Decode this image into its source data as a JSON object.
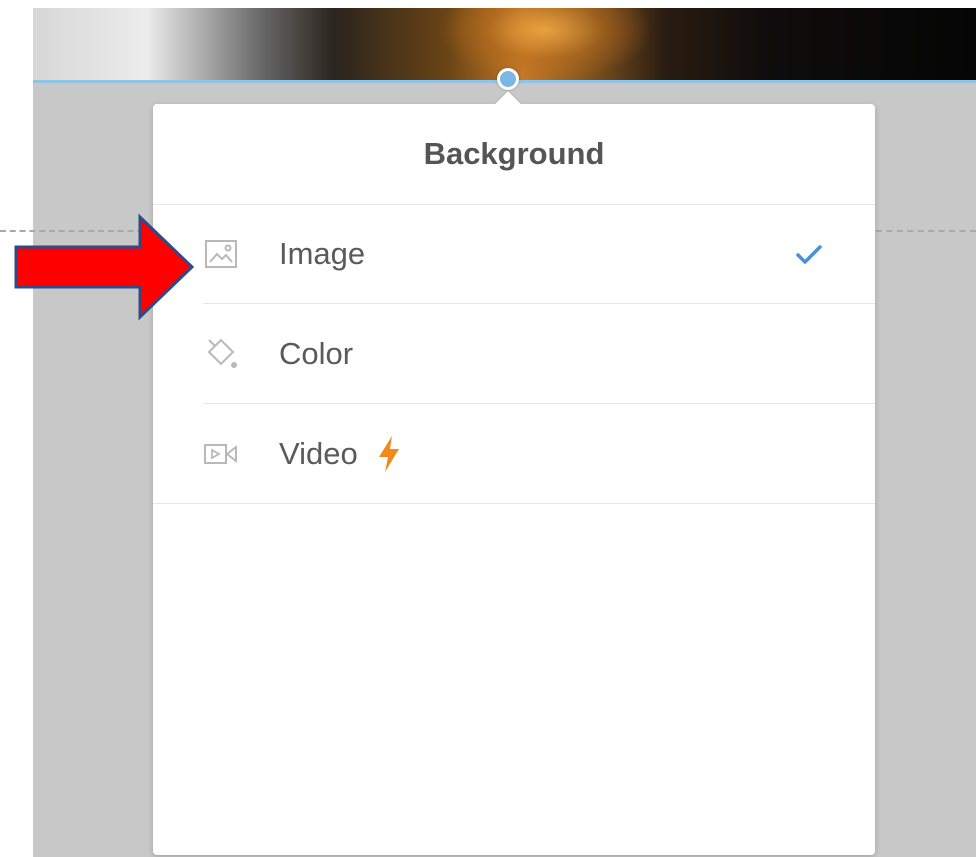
{
  "panel": {
    "title": "Background",
    "options": [
      {
        "label": "Image",
        "icon": "image-icon",
        "selected": true
      },
      {
        "label": "Color",
        "icon": "paint-bucket-icon",
        "selected": false
      },
      {
        "label": "Video",
        "icon": "video-camera-icon",
        "selected": false,
        "badge_icon": "lightning-bolt-icon"
      }
    ]
  },
  "colors": {
    "accent": "#4a90d9",
    "bolt": "#f08a1c",
    "annotation_arrow": "#ff0000",
    "arrow_outline": "#2e4a8a"
  }
}
